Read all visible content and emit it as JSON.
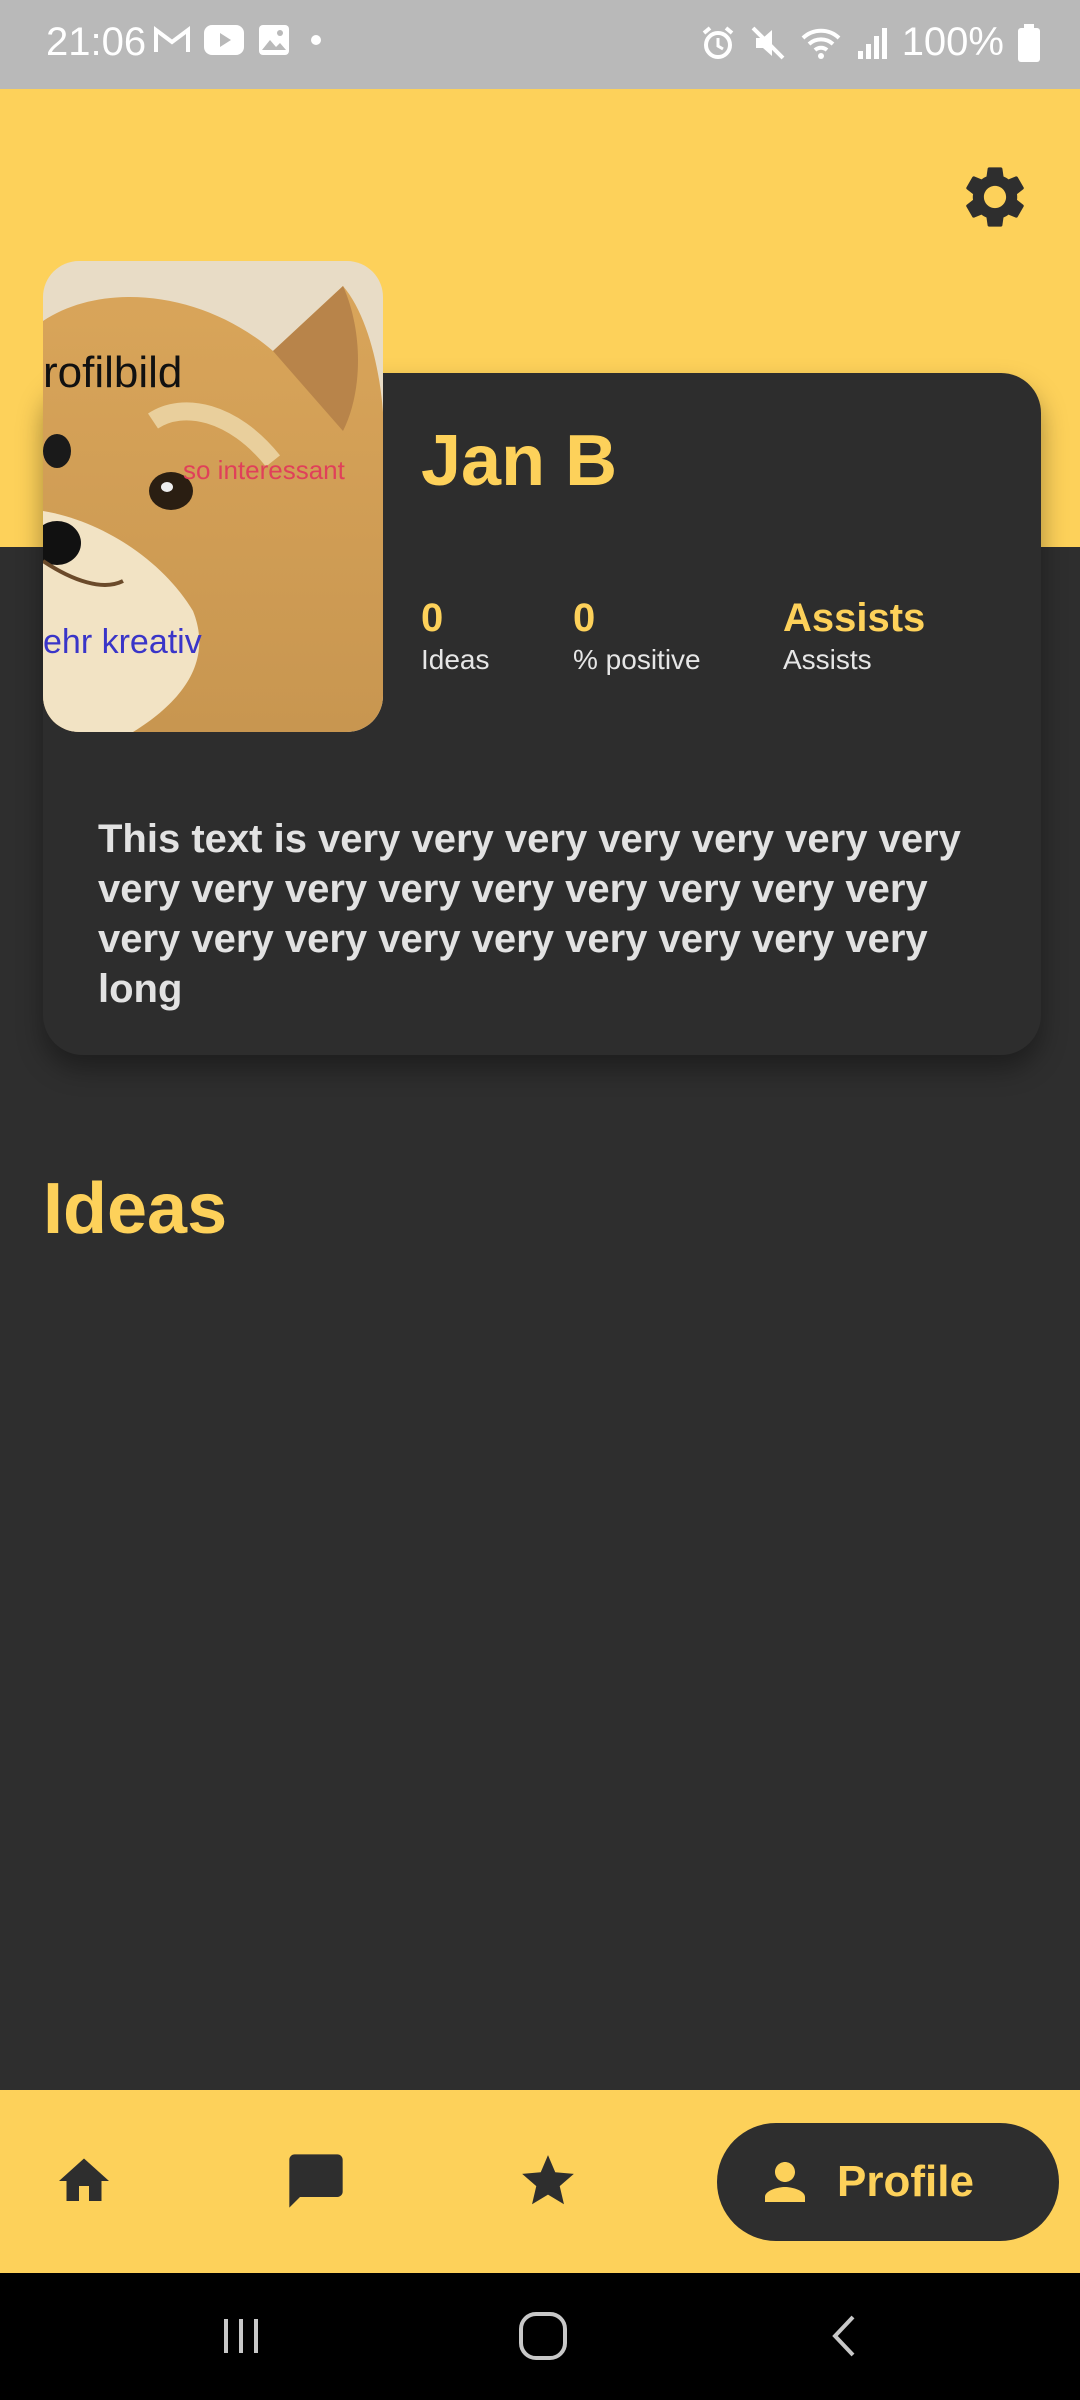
{
  "status_bar": {
    "time": "21:06",
    "battery": "100%",
    "left_icons": [
      "gmail-icon",
      "youtube-icon",
      "gallery-icon",
      "dot-icon"
    ],
    "right_icons": [
      "alarm-icon",
      "mute-icon",
      "wifi-icon",
      "signal-icon",
      "battery-icon"
    ]
  },
  "profile": {
    "name": "Jan B",
    "avatar_text": {
      "top": "rofilbild",
      "middle": "so interessant",
      "bottom": "ehr kreativ"
    },
    "stats": [
      {
        "value": "0",
        "label": "Ideas"
      },
      {
        "value": "0",
        "label": "% positive"
      },
      {
        "value": "Assists",
        "label": "Assists"
      }
    ],
    "bio": "This text is very very very very very very very very very very very very very very very very very very very very very very very very very long"
  },
  "main": {
    "section_title": "Ideas"
  },
  "bottom_nav": {
    "items": [
      "home-icon",
      "chat-icon",
      "star-icon"
    ],
    "active_label": "Profile"
  },
  "colors": {
    "accent": "#fdd15a",
    "background": "#2e2e2e",
    "card": "#2d2d2d"
  }
}
